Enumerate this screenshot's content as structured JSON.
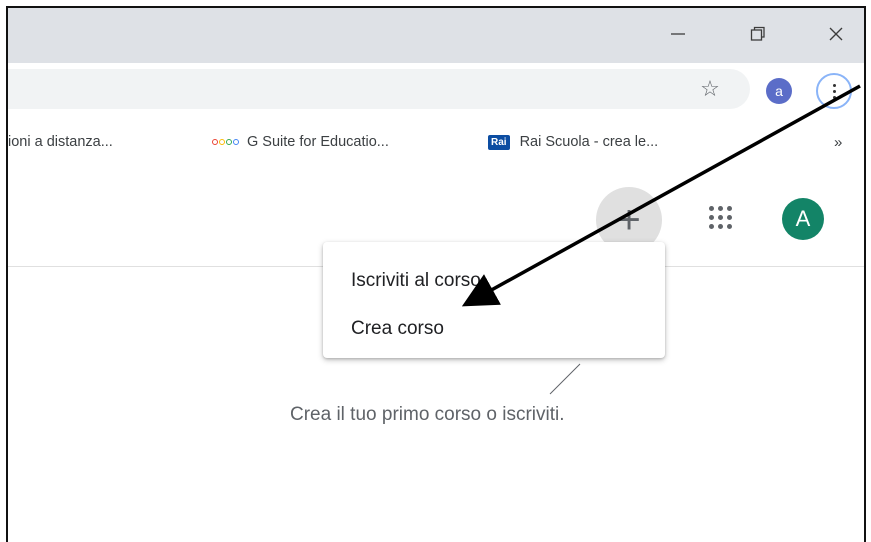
{
  "window": {
    "minimize_icon": "minimize-icon",
    "maximize_icon": "restore-icon",
    "close_icon": "close-icon"
  },
  "toolbar": {
    "bookmark_icon": "star-icon",
    "profile_initial": "a",
    "menu_icon": "three-dots-icon"
  },
  "bookmarks": [
    {
      "label": "ioni a distanza..."
    },
    {
      "label": "G Suite for Educatio...",
      "icon": "gsuite-icon"
    },
    {
      "label": "Rai Scuola - crea le...",
      "icon_text": "Rai"
    }
  ],
  "bookmarks_overflow": "»",
  "appbar": {
    "add_icon": "+",
    "apps_icon": "apps-grid-icon",
    "account_initial": "A"
  },
  "menu": {
    "items": [
      {
        "label": "Iscriviti al corso"
      },
      {
        "label": "Crea corso"
      }
    ]
  },
  "empty_state": {
    "message": "Crea il tuo primo corso o iscriviti."
  },
  "colors": {
    "titlebar": "#dee1e6",
    "profile": "#5b6dc8",
    "avatar": "#138467",
    "rai": "#0c4da2"
  }
}
